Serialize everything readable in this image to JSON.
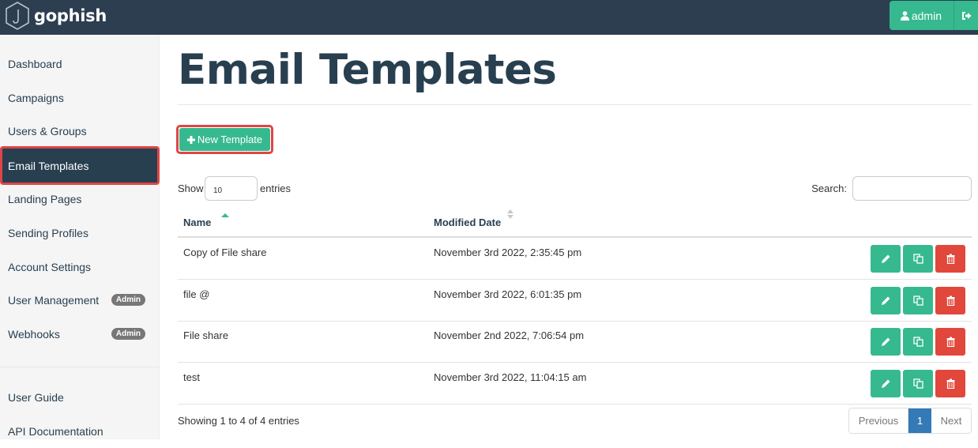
{
  "app": {
    "brand": "gophish",
    "user_label": "admin",
    "icons": {
      "logo": "hexagon-hook-logo",
      "user": "user-icon",
      "logout": "sign-out-icon"
    }
  },
  "sidebar": {
    "items": [
      {
        "label": "Dashboard",
        "active": false
      },
      {
        "label": "Campaigns",
        "active": false
      },
      {
        "label": "Users & Groups",
        "active": false
      },
      {
        "label": "Email Templates",
        "active": true
      },
      {
        "label": "Landing Pages",
        "active": false
      },
      {
        "label": "Sending Profiles",
        "active": false
      },
      {
        "label": "Account Settings",
        "active": false
      },
      {
        "label": "User Management",
        "active": false,
        "badge": "Admin"
      },
      {
        "label": "Webhooks",
        "active": false,
        "badge": "Admin"
      }
    ],
    "bottom_items": [
      {
        "label": "User Guide"
      },
      {
        "label": "API Documentation"
      }
    ]
  },
  "main": {
    "title": "Email Templates",
    "new_button_label": "New Template",
    "show_label": "Show",
    "page_length_value": "10",
    "entries_label": "entries",
    "search_label": "Search:",
    "search_value": "",
    "table": {
      "columns": [
        "Name",
        "Modified Date"
      ],
      "sort": {
        "column": "Name",
        "direction": "ascending"
      },
      "rows": [
        {
          "name": "Copy of File share",
          "modified": "November 3rd 2022, 2:35:45 pm"
        },
        {
          "name": "file @",
          "modified": "November 3rd 2022, 6:01:35 pm"
        },
        {
          "name": "File share",
          "modified": "November 2nd 2022, 7:06:54 pm"
        },
        {
          "name": "test",
          "modified": "November 3rd 2022, 11:04:15 am"
        }
      ],
      "row_actions": [
        "edit",
        "copy",
        "delete"
      ]
    },
    "info_text": "Showing 1 to 4 of 4 entries",
    "pagination": {
      "previous": "Previous",
      "current": "1",
      "next": "Next"
    }
  },
  "colors": {
    "navbar": "#2c3e50",
    "accent_green": "#37b98f",
    "danger_red": "#e1473b",
    "highlight_outline": "#e04545",
    "page_active": "#337ab7",
    "sidebar_bg": "#f5f5f5"
  }
}
